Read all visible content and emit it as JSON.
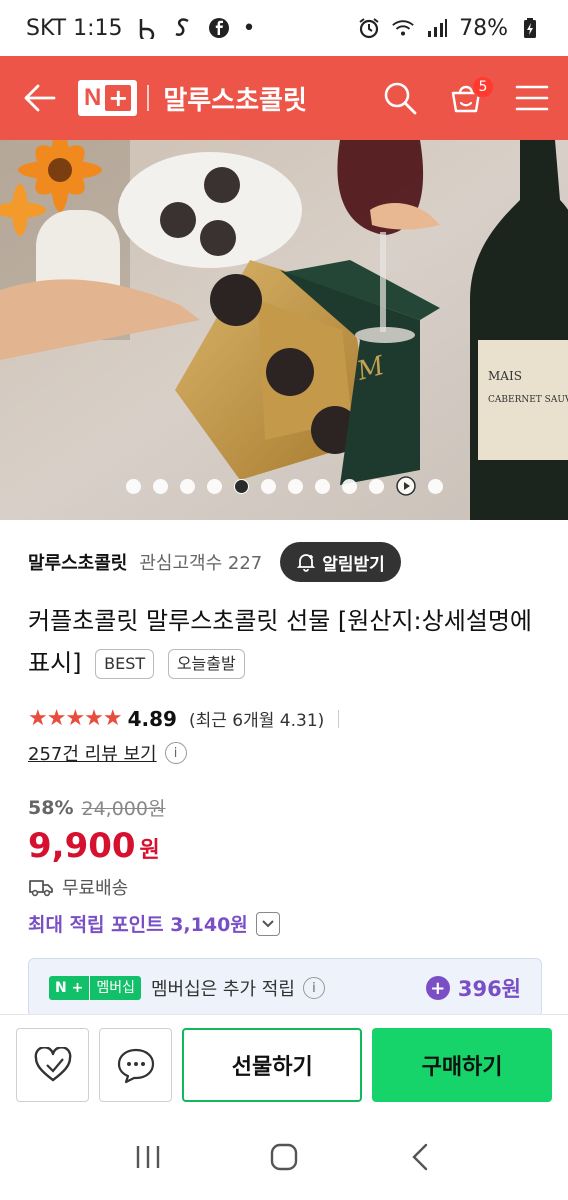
{
  "status_bar": {
    "carrier_time": "SKT 1:15",
    "battery": "78%"
  },
  "header": {
    "logo_n": "N",
    "logo_plus": "+",
    "store_name": "말루스초콜릿",
    "cart_count": "5",
    "accent": "#ec5548"
  },
  "gallery": {
    "dot_count": 12,
    "active_index": 4
  },
  "product": {
    "seller": "말루스초콜릿",
    "fans_label": "관심고객수 227",
    "alarm_label": "알림받기",
    "title": "커플초콜릿 말루스초콜릿 선물 [원산지:상세설명에 표시]",
    "tag_best": "BEST",
    "tag_today": "오늘출발",
    "stars": "★★★★★",
    "rating": "4.89",
    "recent_rating": "(최근 6개월 4.31)",
    "review_link": "257건 리뷰 보기",
    "info_glyph": "i",
    "discount": "58%",
    "original_price": "24,000원",
    "price": "9,900",
    "currency": "원",
    "shipping": "무료배송",
    "max_points": "최대 적립 포인트 3,140원"
  },
  "membership": {
    "badge_n": "N +",
    "badge_label": "멤버십",
    "text": "멤버십은 추가 적립",
    "points": "396원"
  },
  "bottom_bar": {
    "gift_label": "선물하기",
    "buy_label": "구매하기"
  },
  "colors": {
    "price_red": "#d6102f",
    "point_purple": "#7a4fc5",
    "buy_green": "#16d36a"
  }
}
